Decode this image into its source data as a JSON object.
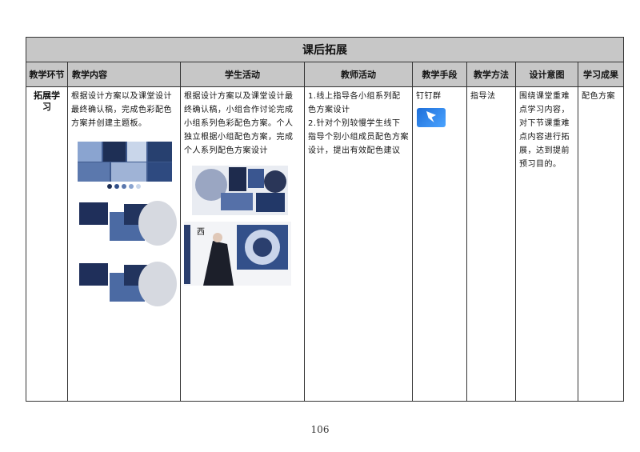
{
  "table": {
    "title": "课后拓展",
    "headers": [
      "教学环节",
      "教学内容",
      "学生活动",
      "教师活动",
      "教学手段",
      "教学方法",
      "设计意图",
      "学习成果"
    ],
    "row": {
      "stage": "拓展学习",
      "content": "根据设计方案以及课堂设计最终确认稿，完成色彩配色方案并创建主题板。",
      "student": "根据设计方案以及课堂设计最终确认稿，小组合作讨论完成小组系列色彩配色方案。个人独立根据小组配色方案，完成个人系列配色方案设计",
      "teacher": "1.线上指导各小组系列配色方案设计\n2.针对个别较慢学生线下指导个别小组成员配色方案设计，提出有效配色建议",
      "means": "钉钉群",
      "method": "指导法",
      "intent": "围绕课堂重难点学习内容，对下节课重难点内容进行拓展，达到提前预习目的。",
      "result": "配色方案"
    }
  },
  "page_number": "106",
  "colors": {
    "header_bg": "#c7c7c7",
    "border": "#333333",
    "indigo": "#2b3f6e"
  },
  "icons": {
    "means_icon": "dingtalk-icon"
  }
}
